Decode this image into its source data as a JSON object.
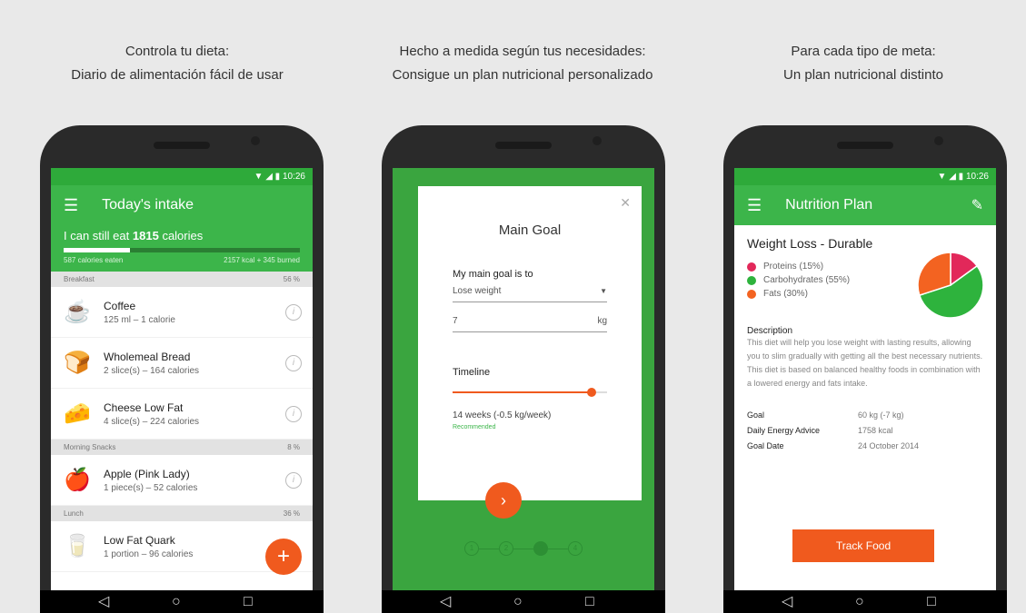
{
  "captions": [
    {
      "line1": "Controla tu dieta:",
      "line2": "Diario de alimentación fácil de usar"
    },
    {
      "line1": "Hecho a medida según tus necesidades:",
      "line2": "Consigue un plan nutricional personalizado"
    },
    {
      "line1": "Para cada tipo de meta:",
      "line2": "Un plan nutricional distinto"
    }
  ],
  "colors": {
    "green": "#3cb54a",
    "orange": "#f05a1e",
    "protein": "#e2285a",
    "carb": "#2eb33d",
    "fat": "#f36321"
  },
  "screen1": {
    "status_time": "10:26",
    "title": "Today's intake",
    "eat_prefix": "I can still eat",
    "eat_value": "1815",
    "eat_suffix": "calories",
    "progress": 0.28,
    "eaten": "587 calories eaten",
    "budget": "2157 kcal + 345 burned",
    "sections": [
      {
        "name": "Breakfast",
        "pct": "56 %"
      },
      {
        "name": "Morning Snacks",
        "pct": "8 %"
      },
      {
        "name": "Lunch",
        "pct": "36 %"
      }
    ],
    "foods": [
      {
        "icon": "coffee-icon",
        "name": "Coffee",
        "detail": "125 ml –   1 calorie"
      },
      {
        "icon": "bread-icon",
        "name": "Wholemeal Bread",
        "detail": "2 slice(s)  –  164 calories"
      },
      {
        "icon": "cheese-icon",
        "name": "Cheese Low Fat",
        "detail": "4 slice(s)  –  224 calories"
      },
      {
        "icon": "apple-icon",
        "name": "Apple (Pink Lady)",
        "detail": "1 piece(s)  –  52 calories"
      },
      {
        "icon": "quark-icon",
        "name": "Low Fat Quark",
        "detail": "1 portion  –  96 calories"
      }
    ],
    "fab": "+"
  },
  "screen2": {
    "title": "Main Goal",
    "goal_label": "My main goal is to",
    "goal_value": "Lose weight",
    "weight_value": "7",
    "weight_unit": "kg",
    "timeline_label": "Timeline",
    "timeline_progress": 0.9,
    "timeline_value": "14 weeks (-0.5 kg/week)",
    "recommended": "Recommended",
    "steps": [
      "1",
      "2",
      "3",
      "4"
    ],
    "active_step": 3
  },
  "screen3": {
    "status_time": "10:26",
    "title": "Nutrition Plan",
    "plan_name": "Weight Loss - Durable",
    "legend": [
      {
        "label": "Proteins (15%)",
        "pct": 15
      },
      {
        "label": "Carbohydrates (55%)",
        "pct": 55
      },
      {
        "label": "Fats (30%)",
        "pct": 30
      }
    ],
    "description_title": "Description",
    "description": "This diet will help you lose weight with lasting results, allowing you to slim gradually with getting all the best necessary nutrients. This diet is based on balanced healthy foods in combination with a lowered energy and fats intake.",
    "goals": [
      {
        "k": "Goal",
        "v": "60 kg (-7 kg)"
      },
      {
        "k": "Daily Energy Advice",
        "v": "1758 kcal"
      },
      {
        "k": "Goal Date",
        "v": "24 October 2014"
      }
    ],
    "button": "Track Food"
  }
}
